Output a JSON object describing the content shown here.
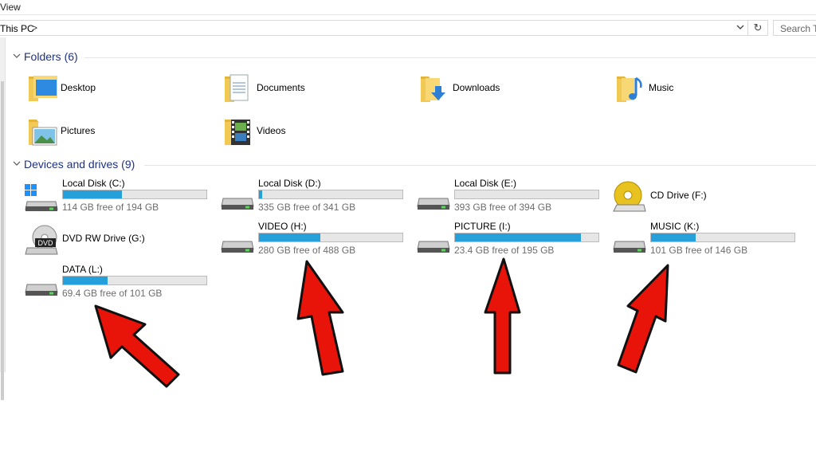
{
  "menu": {
    "view_label": "View"
  },
  "address": {
    "path": "This PC",
    "separator": ">"
  },
  "search": {
    "placeholder": "Search Th"
  },
  "folders": {
    "header": "Folders (6)",
    "items": [
      {
        "label": "Desktop",
        "icon": "desktop-folder-icon"
      },
      {
        "label": "Documents",
        "icon": "documents-folder-icon"
      },
      {
        "label": "Downloads",
        "icon": "downloads-folder-icon"
      },
      {
        "label": "Music",
        "icon": "music-folder-icon"
      },
      {
        "label": "Pictures",
        "icon": "pictures-folder-icon"
      },
      {
        "label": "Videos",
        "icon": "videos-folder-icon"
      }
    ]
  },
  "drives": {
    "header": "Devices and drives (9)",
    "items": [
      {
        "name": "Local Disk (C:)",
        "free": "114 GB free of 194 GB",
        "used_fraction": 0.41,
        "icon": "windows-drive-icon"
      },
      {
        "name": "Local Disk (D:)",
        "free": "335 GB free of 341 GB",
        "used_fraction": 0.02,
        "icon": "hard-drive-icon"
      },
      {
        "name": "Local Disk (E:)",
        "free": "393 GB free of 394 GB",
        "used_fraction": 0.0,
        "icon": "hard-drive-icon"
      },
      {
        "name": "CD Drive (F:)",
        "icon": "cd-drive-icon"
      },
      {
        "name": "DVD RW Drive (G:)",
        "icon": "dvd-drive-icon"
      },
      {
        "name": "VIDEO (H:)",
        "free": "280 GB free of 488 GB",
        "used_fraction": 0.43,
        "icon": "hard-drive-icon"
      },
      {
        "name": "PICTURE (I:)",
        "free": "23.4 GB free of 195 GB",
        "used_fraction": 0.88,
        "icon": "hard-drive-icon"
      },
      {
        "name": "MUSIC (K:)",
        "free": "101 GB free of 146 GB",
        "used_fraction": 0.31,
        "icon": "hard-drive-icon"
      },
      {
        "name": "DATA (L:)",
        "free": "69.4 GB free of 101 GB",
        "used_fraction": 0.31,
        "icon": "hard-drive-icon"
      }
    ]
  },
  "colors": {
    "accent": "#26a0da",
    "header_text": "#1e3287",
    "arrow": "#e8140a"
  }
}
